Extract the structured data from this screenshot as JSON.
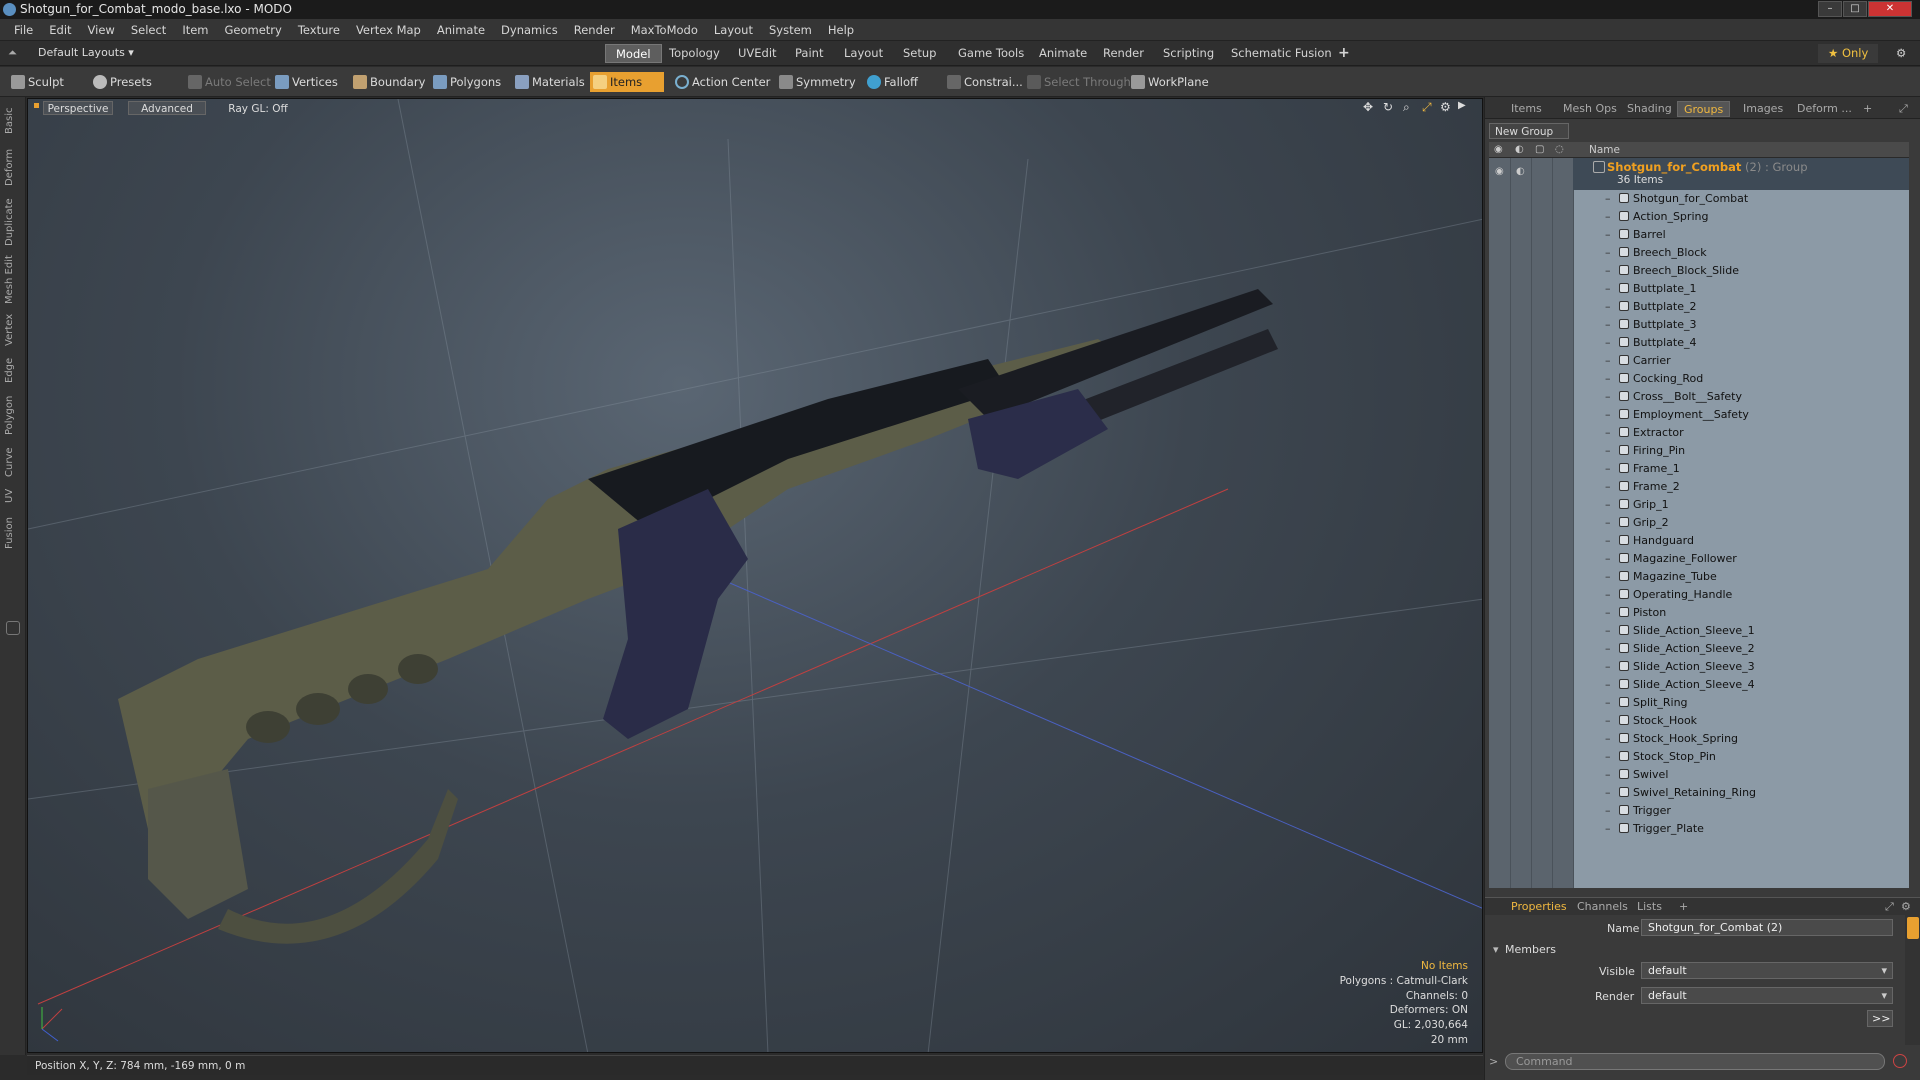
{
  "window": {
    "title": "Shotgun_for_Combat_modo_base.lxo - MODO",
    "minimize": "–",
    "maximize": "□",
    "close": "✕"
  },
  "menu": [
    "File",
    "Edit",
    "View",
    "Select",
    "Item",
    "Geometry",
    "Texture",
    "Vertex Map",
    "Animate",
    "Dynamics",
    "Render",
    "MaxToModo",
    "Layout",
    "System",
    "Help"
  ],
  "layoutbar": {
    "layouts_label": "Default Layouts ▾",
    "tabs": [
      "Model",
      "Topology",
      "UVEdit",
      "Paint",
      "Layout",
      "Setup",
      "Game Tools",
      "Animate",
      "Render",
      "Scripting",
      "Schematic Fusion"
    ],
    "active_tab": "Model",
    "add": "+",
    "only": "★  Only",
    "settings": "⚙"
  },
  "toolbar": {
    "sculpt": "Sculpt",
    "presets": "Presets",
    "auto_select": "Auto Select",
    "vertices": "Vertices",
    "boundary": "Boundary",
    "polygons": "Polygons",
    "materials": "Materials",
    "items": "Items",
    "action_center": "Action Center",
    "symmetry": "Symmetry",
    "falloff": "Falloff",
    "constrain": "Constrai...",
    "select_through": "Select Through",
    "workplane": "WorkPlane"
  },
  "left_tabs": [
    "Basic",
    "Deform",
    "Duplicate",
    "Mesh Edit",
    "Vertex",
    "Edge",
    "Polygon",
    "Curve",
    "UV",
    "Fusion"
  ],
  "viewport": {
    "perspective": "Perspective",
    "advanced": "Advanced",
    "raygl": "Ray GL: Off",
    "info": {
      "no_items": "No Items",
      "polygons": "Polygons : Catmull-Clark",
      "channels": "Channels: 0",
      "deformers": "Deformers: ON",
      "gl": "GL: 2,030,664",
      "scale": "20 mm"
    }
  },
  "status": {
    "position": "Position X, Y, Z:  784 mm, -169 mm, 0 m"
  },
  "right_tabs": [
    "Items",
    "Mesh Ops",
    "Shading",
    "Groups",
    "Images",
    "Deform ..."
  ],
  "right_tabs_active": "Groups",
  "groups": {
    "new_group": "New Group",
    "name_header": "Name",
    "group_name": "Shotgun_for_Combat",
    "group_type": " (2) : Group",
    "count": "36 Items",
    "items": [
      "Shotgun_for_Combat",
      "Action_Spring",
      "Barrel",
      "Breech_Block",
      "Breech_Block_Slide",
      "Buttplate_1",
      "Buttplate_2",
      "Buttplate_3",
      "Buttplate_4",
      "Carrier",
      "Cocking_Rod",
      "Cross__Bolt__Safety",
      "Employment__Safety",
      "Extractor",
      "Firing_Pin",
      "Frame_1",
      "Frame_2",
      "Grip_1",
      "Grip_2",
      "Handguard",
      "Magazine_Follower",
      "Magazine_Tube",
      "Operating_Handle",
      "Piston",
      "Slide_Action_Sleeve_1",
      "Slide_Action_Sleeve_2",
      "Slide_Action_Sleeve_3",
      "Slide_Action_Sleeve_4",
      "Split_Ring",
      "Stock_Hook",
      "Stock_Hook_Spring",
      "Stock_Stop_Pin",
      "Swivel",
      "Swivel_Retaining_Ring",
      "Trigger",
      "Trigger_Plate"
    ]
  },
  "properties": {
    "tabs": [
      "Properties",
      "Channels",
      "Lists"
    ],
    "active": "Properties",
    "name_label": "Name",
    "name_value": "Shotgun_for_Combat (2)",
    "members": "Members",
    "visible_label": "Visible",
    "visible_value": "default",
    "render_label": "Render",
    "render_value": "default",
    "more": ">>",
    "command_placeholder": "Command"
  },
  "colors": {
    "accent": "#e8a030",
    "viewport_bg": "#3d4650"
  }
}
